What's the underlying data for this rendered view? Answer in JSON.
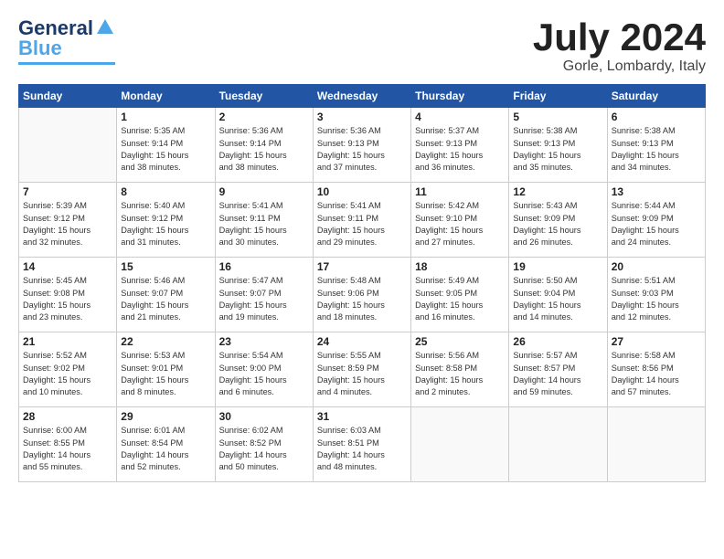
{
  "header": {
    "logo_line1": "General",
    "logo_line2": "Blue",
    "month": "July 2024",
    "location": "Gorle, Lombardy, Italy"
  },
  "weekdays": [
    "Sunday",
    "Monday",
    "Tuesday",
    "Wednesday",
    "Thursday",
    "Friday",
    "Saturday"
  ],
  "weeks": [
    [
      {
        "day": "",
        "info": ""
      },
      {
        "day": "1",
        "info": "Sunrise: 5:35 AM\nSunset: 9:14 PM\nDaylight: 15 hours\nand 38 minutes."
      },
      {
        "day": "2",
        "info": "Sunrise: 5:36 AM\nSunset: 9:14 PM\nDaylight: 15 hours\nand 38 minutes."
      },
      {
        "day": "3",
        "info": "Sunrise: 5:36 AM\nSunset: 9:13 PM\nDaylight: 15 hours\nand 37 minutes."
      },
      {
        "day": "4",
        "info": "Sunrise: 5:37 AM\nSunset: 9:13 PM\nDaylight: 15 hours\nand 36 minutes."
      },
      {
        "day": "5",
        "info": "Sunrise: 5:38 AM\nSunset: 9:13 PM\nDaylight: 15 hours\nand 35 minutes."
      },
      {
        "day": "6",
        "info": "Sunrise: 5:38 AM\nSunset: 9:13 PM\nDaylight: 15 hours\nand 34 minutes."
      }
    ],
    [
      {
        "day": "7",
        "info": "Sunrise: 5:39 AM\nSunset: 9:12 PM\nDaylight: 15 hours\nand 32 minutes."
      },
      {
        "day": "8",
        "info": "Sunrise: 5:40 AM\nSunset: 9:12 PM\nDaylight: 15 hours\nand 31 minutes."
      },
      {
        "day": "9",
        "info": "Sunrise: 5:41 AM\nSunset: 9:11 PM\nDaylight: 15 hours\nand 30 minutes."
      },
      {
        "day": "10",
        "info": "Sunrise: 5:41 AM\nSunset: 9:11 PM\nDaylight: 15 hours\nand 29 minutes."
      },
      {
        "day": "11",
        "info": "Sunrise: 5:42 AM\nSunset: 9:10 PM\nDaylight: 15 hours\nand 27 minutes."
      },
      {
        "day": "12",
        "info": "Sunrise: 5:43 AM\nSunset: 9:09 PM\nDaylight: 15 hours\nand 26 minutes."
      },
      {
        "day": "13",
        "info": "Sunrise: 5:44 AM\nSunset: 9:09 PM\nDaylight: 15 hours\nand 24 minutes."
      }
    ],
    [
      {
        "day": "14",
        "info": "Sunrise: 5:45 AM\nSunset: 9:08 PM\nDaylight: 15 hours\nand 23 minutes."
      },
      {
        "day": "15",
        "info": "Sunrise: 5:46 AM\nSunset: 9:07 PM\nDaylight: 15 hours\nand 21 minutes."
      },
      {
        "day": "16",
        "info": "Sunrise: 5:47 AM\nSunset: 9:07 PM\nDaylight: 15 hours\nand 19 minutes."
      },
      {
        "day": "17",
        "info": "Sunrise: 5:48 AM\nSunset: 9:06 PM\nDaylight: 15 hours\nand 18 minutes."
      },
      {
        "day": "18",
        "info": "Sunrise: 5:49 AM\nSunset: 9:05 PM\nDaylight: 15 hours\nand 16 minutes."
      },
      {
        "day": "19",
        "info": "Sunrise: 5:50 AM\nSunset: 9:04 PM\nDaylight: 15 hours\nand 14 minutes."
      },
      {
        "day": "20",
        "info": "Sunrise: 5:51 AM\nSunset: 9:03 PM\nDaylight: 15 hours\nand 12 minutes."
      }
    ],
    [
      {
        "day": "21",
        "info": "Sunrise: 5:52 AM\nSunset: 9:02 PM\nDaylight: 15 hours\nand 10 minutes."
      },
      {
        "day": "22",
        "info": "Sunrise: 5:53 AM\nSunset: 9:01 PM\nDaylight: 15 hours\nand 8 minutes."
      },
      {
        "day": "23",
        "info": "Sunrise: 5:54 AM\nSunset: 9:00 PM\nDaylight: 15 hours\nand 6 minutes."
      },
      {
        "day": "24",
        "info": "Sunrise: 5:55 AM\nSunset: 8:59 PM\nDaylight: 15 hours\nand 4 minutes."
      },
      {
        "day": "25",
        "info": "Sunrise: 5:56 AM\nSunset: 8:58 PM\nDaylight: 15 hours\nand 2 minutes."
      },
      {
        "day": "26",
        "info": "Sunrise: 5:57 AM\nSunset: 8:57 PM\nDaylight: 14 hours\nand 59 minutes."
      },
      {
        "day": "27",
        "info": "Sunrise: 5:58 AM\nSunset: 8:56 PM\nDaylight: 14 hours\nand 57 minutes."
      }
    ],
    [
      {
        "day": "28",
        "info": "Sunrise: 6:00 AM\nSunset: 8:55 PM\nDaylight: 14 hours\nand 55 minutes."
      },
      {
        "day": "29",
        "info": "Sunrise: 6:01 AM\nSunset: 8:54 PM\nDaylight: 14 hours\nand 52 minutes."
      },
      {
        "day": "30",
        "info": "Sunrise: 6:02 AM\nSunset: 8:52 PM\nDaylight: 14 hours\nand 50 minutes."
      },
      {
        "day": "31",
        "info": "Sunrise: 6:03 AM\nSunset: 8:51 PM\nDaylight: 14 hours\nand 48 minutes."
      },
      {
        "day": "",
        "info": ""
      },
      {
        "day": "",
        "info": ""
      },
      {
        "day": "",
        "info": ""
      }
    ]
  ]
}
